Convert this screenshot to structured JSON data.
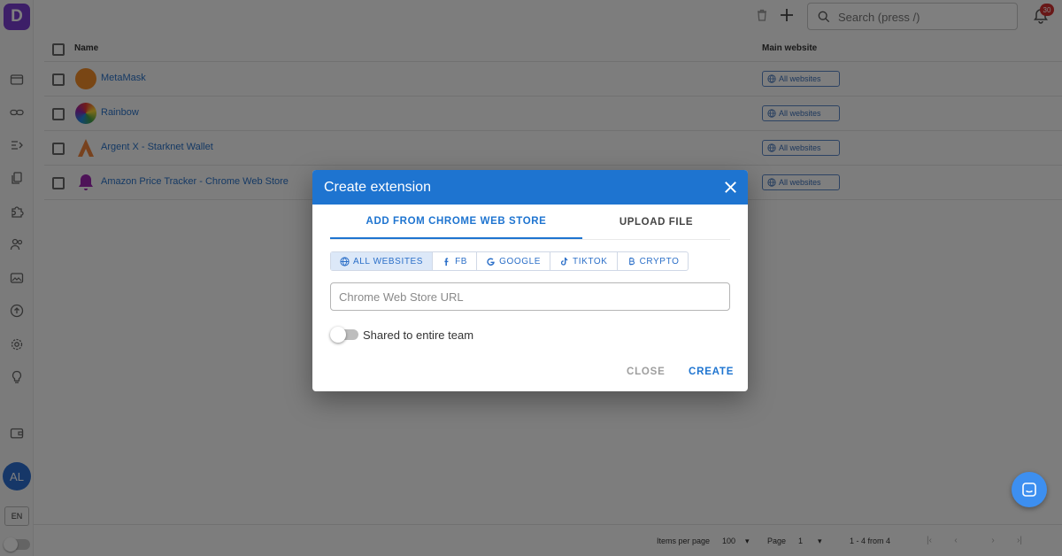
{
  "app": {
    "logo_letter": "D"
  },
  "topbar": {
    "search_placeholder": "Search (press /)",
    "notification_count": "30"
  },
  "table": {
    "headers": {
      "name": "Name",
      "main_website": "Main website"
    },
    "rows": [
      {
        "name": "MetaMask",
        "site": "All websites"
      },
      {
        "name": "Rainbow",
        "site": "All websites"
      },
      {
        "name": "Argent X - Starknet Wallet",
        "site": "All websites"
      },
      {
        "name": "Amazon Price Tracker - Chrome Web Store",
        "site": "All websites"
      }
    ]
  },
  "sidebar": {
    "avatar_initials": "AL",
    "language": "EN"
  },
  "footer": {
    "items_per_page_label": "Items per page",
    "items_per_page_value": "100",
    "page_label": "Page",
    "page_value": "1",
    "range": "1 - 4 from 4"
  },
  "dialog": {
    "title": "Create extension",
    "tabs": [
      "ADD FROM CHROME WEB STORE",
      "UPLOAD FILE"
    ],
    "filters": [
      "ALL WEBSITES",
      "FB",
      "GOOGLE",
      "TIKTOK",
      "CRYPTO"
    ],
    "url_placeholder": "Chrome Web Store URL",
    "shared_label": "Shared to entire team",
    "close_label": "CLOSE",
    "create_label": "CREATE"
  },
  "colors": {
    "primary": "#1e74d0",
    "logo": "#7b3fd1",
    "badge": "#d32f2f"
  }
}
